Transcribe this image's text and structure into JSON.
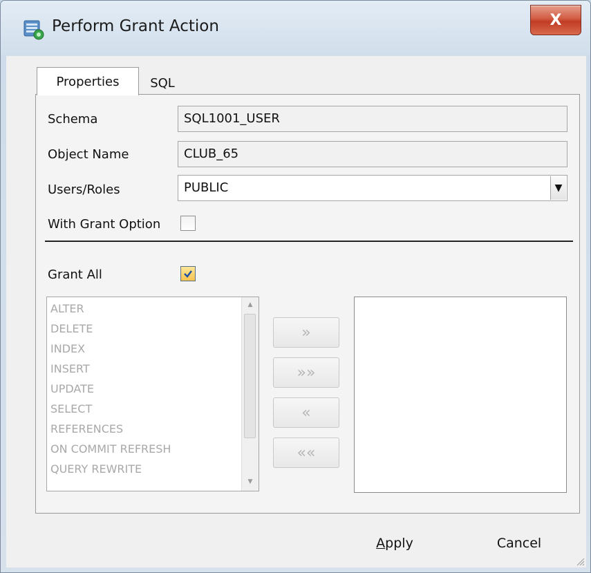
{
  "window": {
    "title": "Perform Grant Action",
    "close_label": "X"
  },
  "tabs": [
    {
      "label": "Properties",
      "active": true
    },
    {
      "label": "SQL",
      "active": false
    }
  ],
  "form": {
    "schema_label": "Schema",
    "schema_value": "SQL1001_USER",
    "object_name_label": "Object Name",
    "object_name_value": "CLUB_65",
    "users_roles_label": "Users/Roles",
    "users_roles_value": "PUBLIC",
    "with_grant_option_label": "With Grant Option",
    "with_grant_option_checked": false,
    "grant_all_label": "Grant All",
    "grant_all_checked": true
  },
  "privileges": [
    "ALTER",
    "DELETE",
    "INDEX",
    "INSERT",
    "UPDATE",
    "SELECT",
    "REFERENCES",
    "ON COMMIT REFRESH",
    "QUERY REWRITE"
  ],
  "move_buttons": {
    "add_one": "»",
    "add_all": "»»",
    "remove_one": "«",
    "remove_all": "««"
  },
  "footer": {
    "apply_first": "A",
    "apply_rest": "pply",
    "cancel_label": "Cancel"
  },
  "icons": {
    "app": "database-grant-icon",
    "close": "close-icon",
    "dropdown": "chevron-down-icon",
    "check": "check-icon"
  }
}
